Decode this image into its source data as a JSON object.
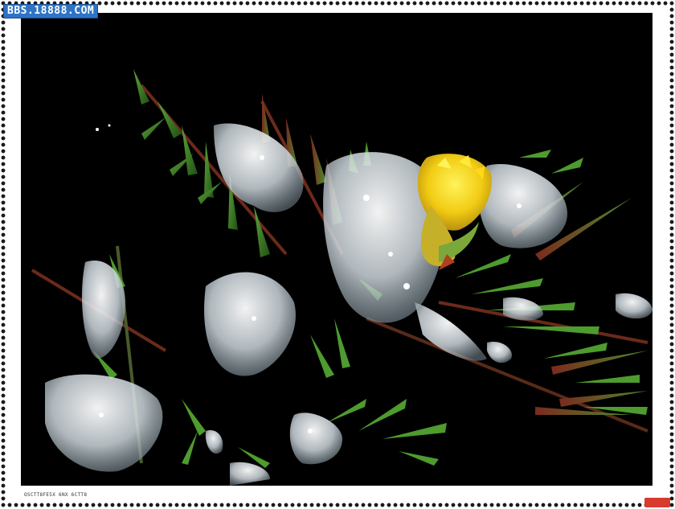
{
  "watermark": {
    "text": "BBS.18888.COM"
  },
  "camera_caption": {
    "text": "OSCTT8FE5X 6NX 6CTT8"
  },
  "photo": {
    "subject": "frozen-yellow-flower",
    "colors": {
      "background": "#000000",
      "flower": "#f4d21c",
      "ice": "#dfe6ea",
      "leaves": "#3d7a24",
      "stems": "#7a2f1f",
      "frame": "#ffffff",
      "watermark_bg": "#2d74c7"
    }
  }
}
